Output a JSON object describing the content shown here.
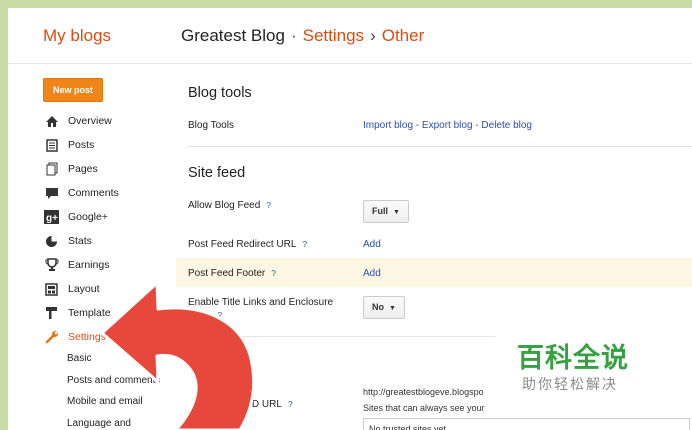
{
  "header": {
    "my_blogs": "My blogs",
    "blog_name": "Greatest Blog",
    "sep1": "·",
    "settings": "Settings",
    "sep2": "›",
    "other": "Other"
  },
  "new_post_label": "New post",
  "sidebar": {
    "items": [
      {
        "label": "Overview",
        "icon": "home-icon"
      },
      {
        "label": "Posts",
        "icon": "posts-icon"
      },
      {
        "label": "Pages",
        "icon": "pages-icon"
      },
      {
        "label": "Comments",
        "icon": "comments-icon"
      },
      {
        "label": "Google+",
        "icon": "google-plus-icon"
      },
      {
        "label": "Stats",
        "icon": "stats-icon"
      },
      {
        "label": "Earnings",
        "icon": "trophy-icon"
      },
      {
        "label": "Layout",
        "icon": "layout-icon"
      },
      {
        "label": "Template",
        "icon": "template-icon"
      },
      {
        "label": "Settings",
        "icon": "wrench-icon",
        "active": true
      }
    ],
    "sub_items": [
      "Basic",
      "Posts and comments",
      "Mobile and email",
      "Language and"
    ]
  },
  "content": {
    "blog_tools": {
      "heading": "Blog tools",
      "row_label": "Blog Tools",
      "import": "Import blog",
      "dash1": " - ",
      "export": "Export blog",
      "dash2": " - ",
      "delete": "Delete blog"
    },
    "site_feed": {
      "heading": "Site feed",
      "allow_label": "Allow Blog Feed",
      "allow_value": "Full",
      "redirect_label": "Post Feed Redirect URL",
      "redirect_action": "Add",
      "footer_label": "Post Feed Footer",
      "footer_action": "Add",
      "title_links_label_1": "Enable Title Links and Enclosure",
      "title_links_label_2": "Links",
      "title_links_value": "No",
      "help": "?"
    },
    "openid": {
      "heading": "Op",
      "url_label": "Your Op    D URL",
      "url_value": "http://greatestblogeve.blogspo",
      "note": "Sites that can always see your",
      "trusted": "No trusted sites yet"
    }
  },
  "watermark": {
    "main": "百科全说",
    "sub": "助你轻松解决"
  },
  "colors": {
    "accent": "#dd4b10",
    "link": "#2a4fb0",
    "new_post": "#f0851a",
    "arrow": "#e8473b",
    "watermark": "#2f9e3a",
    "frame": "#c8dba5"
  }
}
